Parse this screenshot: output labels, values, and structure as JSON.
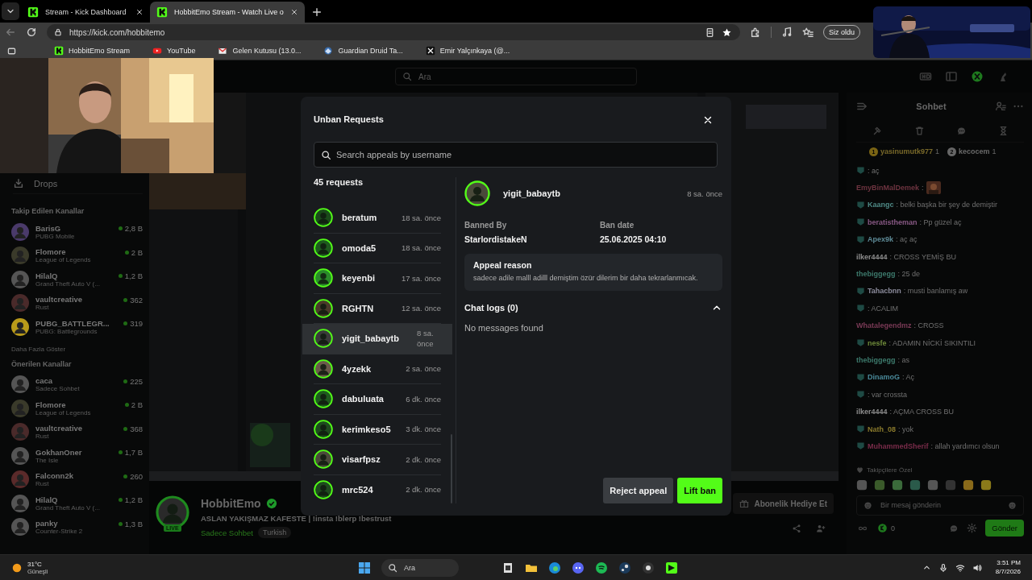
{
  "browser": {
    "tabs": [
      {
        "title": "Stream - Kick Dashboard",
        "selected": false
      },
      {
        "title": "HobbitEmo Stream - Watch Live o",
        "selected": true
      }
    ],
    "url": "https://kick.com/hobbitemo",
    "profile_button": "Siz oldu",
    "bookmarks": [
      "HobbitEmo Stream",
      "YouTube",
      "Gelen Kutusu (13.0...",
      "Guardian Druid Ta...",
      "Emir Yalçınkaya (@..."
    ]
  },
  "page": {
    "search": {
      "placeholder": "Ara"
    },
    "sidebar": {
      "drops": "Drops",
      "sections": [
        {
          "title": "Takip Edilen Kanallar",
          "more": "Daha Fazla Göster",
          "channels": [
            {
              "name": "BarisG",
              "category": "PUBG Mobile",
              "viewers": "2,8 B"
            },
            {
              "name": "Flomore",
              "category": "League of Legends",
              "viewers": "2 B"
            },
            {
              "name": "HilalQ",
              "category": "Grand Theft Auto V (...",
              "viewers": "1,2 B"
            },
            {
              "name": "vaultcreative",
              "category": "Rust",
              "viewers": "362"
            },
            {
              "name": "PUBG_BATTLEGR...",
              "category": "PUBG: Battlegrounds",
              "viewers": "319"
            }
          ]
        },
        {
          "title": "Önerilen Kanallar",
          "channels": [
            {
              "name": "caca",
              "category": "Sadece Sohbet",
              "viewers": "225"
            },
            {
              "name": "Flomore",
              "category": "League of Legends",
              "viewers": "2 B"
            },
            {
              "name": "vaultcreative",
              "category": "Rust",
              "viewers": "368"
            },
            {
              "name": "GokhanOner",
              "category": "The Isle",
              "viewers": "1,7 B"
            },
            {
              "name": "Falconn2k",
              "category": "Rust",
              "viewers": "260"
            },
            {
              "name": "HilalQ",
              "category": "Grand Theft Auto V (...",
              "viewers": "1,2 B"
            },
            {
              "name": "panky",
              "category": "Counter-Strike 2",
              "viewers": "1,3 B"
            }
          ]
        }
      ]
    },
    "stream": {
      "name": "HobbitEmo",
      "verified": true,
      "live_badge": "LIVE",
      "title": "ASLAN YAKIŞMAZ KAFESTE | !insta !blerp !bestrust",
      "category": "Sadece Sohbet",
      "tags": [
        "Turkish"
      ],
      "gift_button": "Abonelik Hediye Et"
    },
    "chat": {
      "title": "Sohbet",
      "leaderboard": [
        {
          "rank": "1",
          "name": "yasinumutk977",
          "count": "1"
        },
        {
          "rank": "2",
          "name": "kecocem",
          "count": "1"
        }
      ],
      "messages": [
        {
          "badge": true,
          "text": ": aç"
        },
        {
          "user": "EmyBinMalDemek",
          "color": "#6e3440",
          "badge": false,
          "text": ":",
          "emote": true
        },
        {
          "user": "Kaangc",
          "color": "#4f8a86",
          "badge": true,
          "text": ": belki başka bir şey de demiştir"
        },
        {
          "user": "beratistheman",
          "color": "#8a5a86",
          "badge": true,
          "text": ": Pp güzel aç"
        },
        {
          "user": "Apex9k",
          "color": "#5e8a96",
          "badge": true,
          "text": ": aç aç"
        },
        {
          "user": "ilker4444",
          "color": "#8e8e8e",
          "badge": false,
          "text": ": CROSS YEMİŞ BU"
        },
        {
          "user": "thebiggegg",
          "color": "#3d7a6c",
          "badge": false,
          "text": ": 25 de"
        },
        {
          "user": "Tahacbnn",
          "color": "#8c8c9c",
          "badge": true,
          "text": ": musti banlamış aw"
        },
        {
          "badge": true,
          "text": ": ACALIM"
        },
        {
          "user": "Whatalegendmz",
          "color": "#7a3a56",
          "badge": false,
          "text": ": CROSS"
        },
        {
          "user": "nesfe",
          "color": "#6e8a3a",
          "badge": true,
          "text": ": ADAMIN NİCKİ SIKINTILI"
        },
        {
          "user": "thebiggegg",
          "color": "#3d7a6c",
          "badge": false,
          "text": ": as"
        },
        {
          "user": "DinamoG",
          "color": "#4a8a9a",
          "badge": true,
          "text": ": Aç"
        },
        {
          "badge": true,
          "text": ": var crossta"
        },
        {
          "user": "ilker4444",
          "color": "#8e8e8e",
          "badge": false,
          "text": ": AÇMA CROSS BU"
        },
        {
          "user": "Nath_08",
          "color": "#8a7a2c",
          "badge": true,
          "text": ": yok"
        },
        {
          "user": "MuhammedSherif",
          "color": "#7a2c4a",
          "badge": true,
          "text": ": allah yardımcı olsun"
        }
      ],
      "followers_only": "Takipçilere Özel",
      "input_placeholder": "Bir mesaj gönderin",
      "points": "0",
      "send_button": "Gönder"
    }
  },
  "unban_modal": {
    "title": "Unban Requests",
    "search_placeholder": "Search appeals by username",
    "count": "45 requests",
    "requests": [
      {
        "user": "beratum",
        "time": "18 sa. önce",
        "selected": false
      },
      {
        "user": "omoda5",
        "time": "18 sa. önce",
        "selected": false
      },
      {
        "user": "keyenbi",
        "time": "17 sa. önce",
        "selected": false
      },
      {
        "user": "RGHTN",
        "time": "12 sa. önce",
        "selected": false
      },
      {
        "user": "yigit_babaytb",
        "time": "8 sa. önce",
        "selected": true
      },
      {
        "user": "4yzekk",
        "time": "2 sa. önce",
        "selected": false
      },
      {
        "user": "dabuluata",
        "time": "6 dk. önce",
        "selected": false
      },
      {
        "user": "kerimkeso5",
        "time": "3 dk. önce",
        "selected": false
      },
      {
        "user": "visarfpsz",
        "time": "2 dk. önce",
        "selected": false
      },
      {
        "user": "mrc524",
        "time": "2 dk. önce",
        "selected": false
      }
    ],
    "detail": {
      "user": "yigit_babaytb",
      "time": "8 sa. önce",
      "banned_by_label": "Banned By",
      "banned_by": "StarlordistakeN",
      "ban_date_label": "Ban date",
      "ban_date": "25.06.2025 04:10",
      "reason_title": "Appeal reason",
      "reason": "sadece adile malll adilll demiştim özür dilerim bir daha tekrarlanmıcak.",
      "chat_logs": {
        "title": "Chat logs (0)",
        "expanded": true,
        "empty": "No messages found"
      }
    },
    "buttons": {
      "reject": "Reject appeal",
      "lift": "Lift ban"
    }
  },
  "taskbar": {
    "temperature": "31°C",
    "weather": "Güneşli",
    "search_placeholder": "Ara",
    "time": "3:51 PM",
    "date": "8/7/2026"
  }
}
